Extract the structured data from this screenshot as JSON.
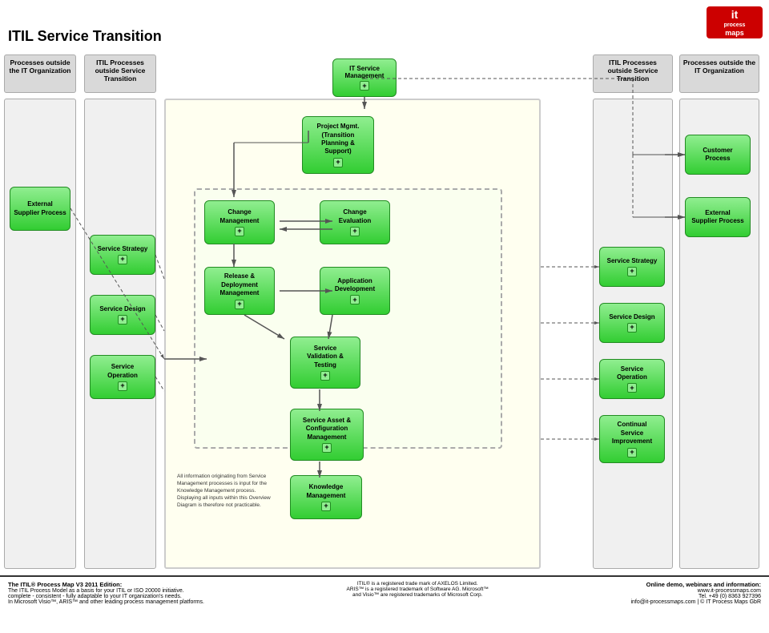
{
  "logo": {
    "line1": "it",
    "line2": "process",
    "line3": "maps"
  },
  "title": "ITIL Service Transition",
  "columns": {
    "left1": "Processes outside the IT Organization",
    "left2": "ITIL Processes outside Service Transition",
    "right1": "ITIL Processes outside Service Transition",
    "right2": "Processes outside the IT Organization"
  },
  "boxes": {
    "itsm": {
      "label": "IT Service\nManagement",
      "plus": "+"
    },
    "external_supplier_left": {
      "label": "External\nSupplier Process",
      "plus": null
    },
    "service_strategy_left": {
      "label": "Service Strategy",
      "plus": "+"
    },
    "service_design_left": {
      "label": "Service Design",
      "plus": "+"
    },
    "service_operation_left": {
      "label": "Service Operation",
      "plus": "+"
    },
    "project_mgmt": {
      "label": "Project Mgmt.\n(Transition\nPlanning &\nSupport)",
      "plus": "+"
    },
    "change_mgmt": {
      "label": "Change\nManagement",
      "plus": "+"
    },
    "change_eval": {
      "label": "Change\nEvaluation",
      "plus": "+"
    },
    "release_deploy": {
      "label": "Release &\nDeployment\nManagement",
      "plus": "+"
    },
    "app_dev": {
      "label": "Application\nDevelopment",
      "plus": "+"
    },
    "service_validation": {
      "label": "Service\nValidation &\nTesting",
      "plus": "+"
    },
    "service_asset": {
      "label": "Service Asset &\nConfiguration\nManagement",
      "plus": "+"
    },
    "knowledge": {
      "label": "Knowledge\nManagement",
      "plus": "+"
    },
    "customer_process": {
      "label": "Customer\nProcess",
      "plus": null
    },
    "external_supplier_right": {
      "label": "External\nSupplier Process",
      "plus": null
    },
    "service_strategy_right": {
      "label": "Service Strategy",
      "plus": "+"
    },
    "service_design_right": {
      "label": "Service Design",
      "plus": "+"
    },
    "service_operation_right": {
      "label": "Service\nOperation",
      "plus": "+"
    },
    "continual_service": {
      "label": "Continual\nService\nImprovement",
      "plus": "+"
    }
  },
  "note": "All information originating from Service Management processes is input for the Knowledge Management process. Displaying all inputs within this Overview Diagram is therefore not practicable.",
  "footer": {
    "left_title": "The ITIL® Process Map V3 2011 Edition:",
    "left_text": "The ITIL Process Model as a basis for your ITIL or ISO 20000 initiative.\ncomplete - consistent - fully adaptable to your IT organization's needs.\nIn Microsoft Visio™, ARIS™ and other leading process management platforms.",
    "center_text": "ITIL® is a registered trade mark of AXELOS Limited.\nARIS™ is a registered trademark of Software AG. Microsoft™\nand Visio™ are registered trademarks of Microsoft Corp.",
    "right_title": "Online demo, webinars and information:",
    "right_text": "www.it-processmaps.com\nTel. +49 (0) 8363 927396\ninfo@it-processmaps.com | © IT Process Maps GbR"
  }
}
